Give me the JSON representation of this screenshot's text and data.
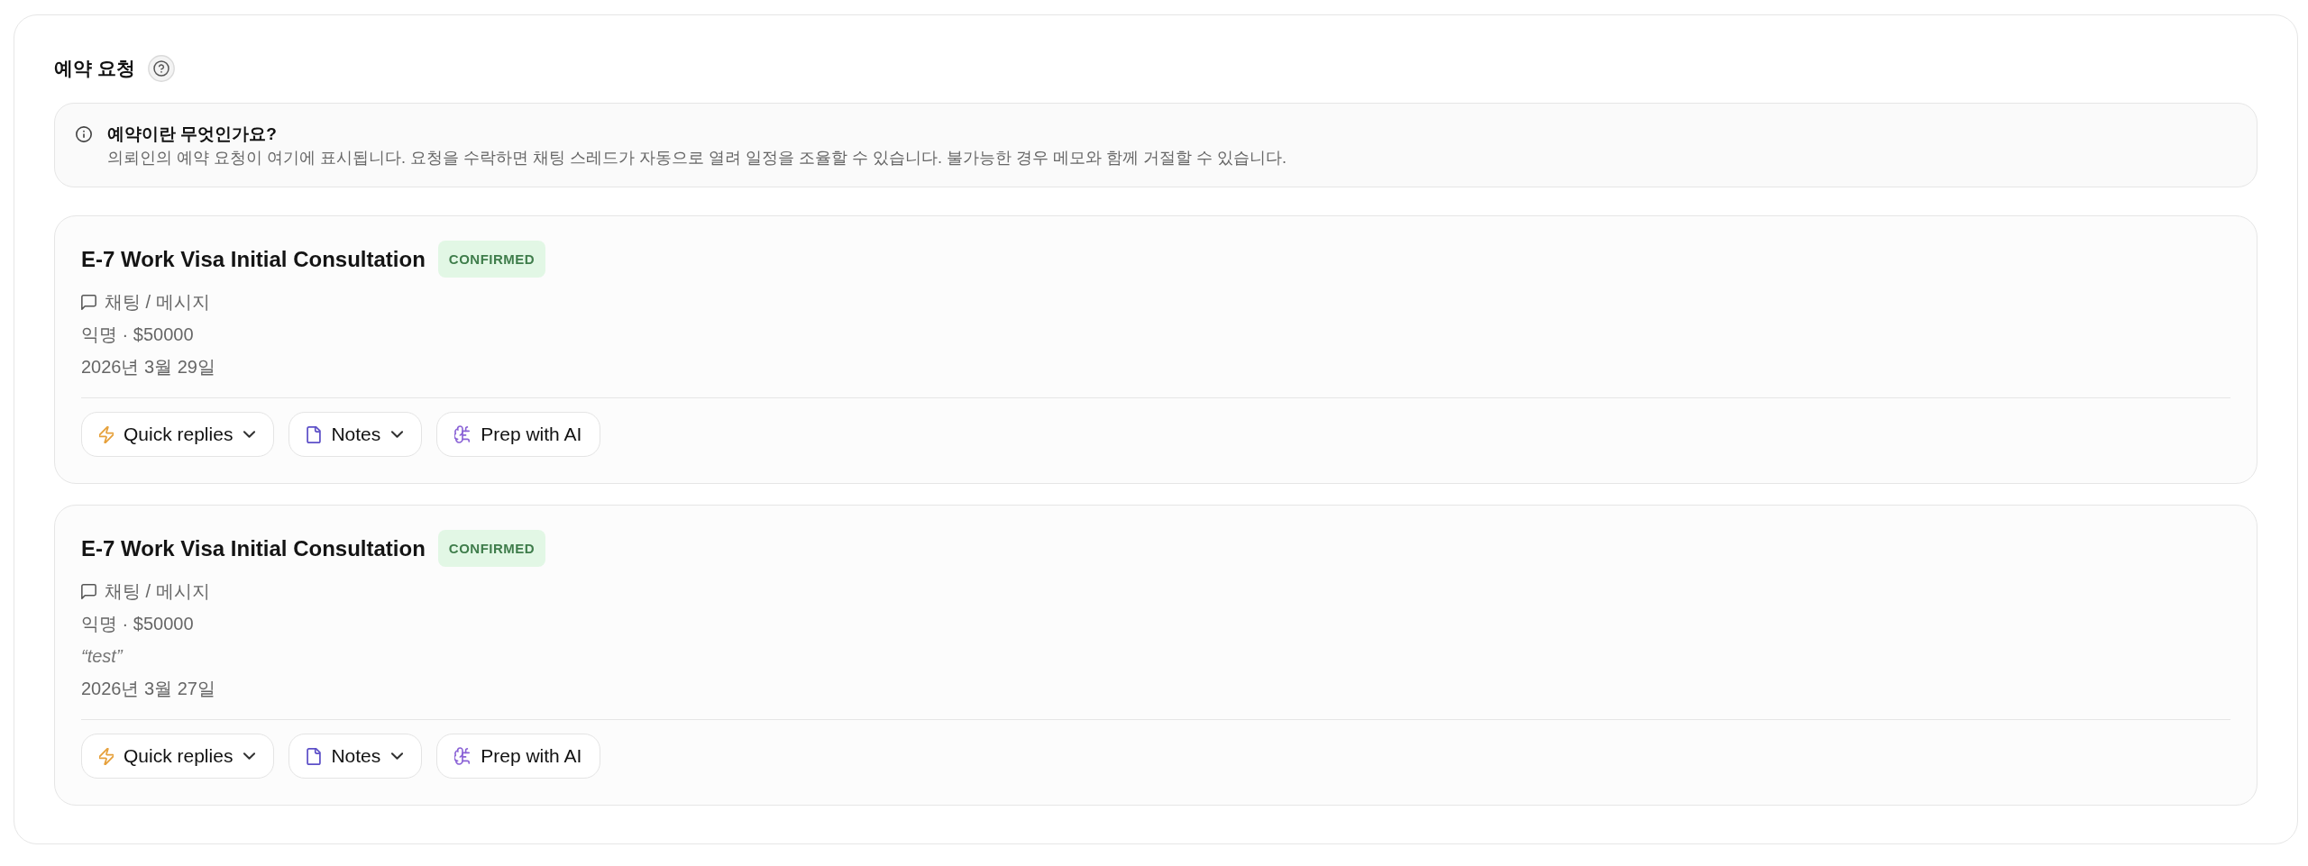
{
  "header": {
    "title": "예약 요청"
  },
  "info": {
    "title": "예약이란 무엇인가요?",
    "text": "의뢰인의 예약 요청이 여기에 표시됩니다. 요청을 수락하면 채팅 스레드가 자동으로 열려 일정을 조율할 수 있습니다. 불가능한 경우 메모와 함께 거절할 수 있습니다."
  },
  "bookings": [
    {
      "title": "E-7 Work Visa Initial Consultation",
      "status": {
        "label": "CONFIRMED",
        "kind": "confirmed"
      },
      "channel": "채팅 / 메시지",
      "client": "익명 · $50000",
      "date": "2026년 3월 29일",
      "actions": [
        {
          "label": "Quick replies",
          "kind": "replies",
          "dropdown": true
        },
        {
          "label": "Notes",
          "kind": "notes",
          "dropdown": true
        },
        {
          "label": "Prep with AI",
          "kind": "prep",
          "dropdown": false
        }
      ]
    },
    {
      "title": "E-7 Work Visa Initial Consultation",
      "status": {
        "label": "CONFIRMED",
        "kind": "confirmed"
      },
      "channel": "채팅 / 메시지",
      "client": "익명 · $50000",
      "note": "“test”",
      "date": "2026년 3월 27일",
      "actions": [
        {
          "label": "Quick replies",
          "kind": "replies",
          "dropdown": true
        },
        {
          "label": "Notes",
          "kind": "notes",
          "dropdown": true
        },
        {
          "label": "Prep with AI",
          "kind": "prep",
          "dropdown": false
        }
      ]
    }
  ]
}
